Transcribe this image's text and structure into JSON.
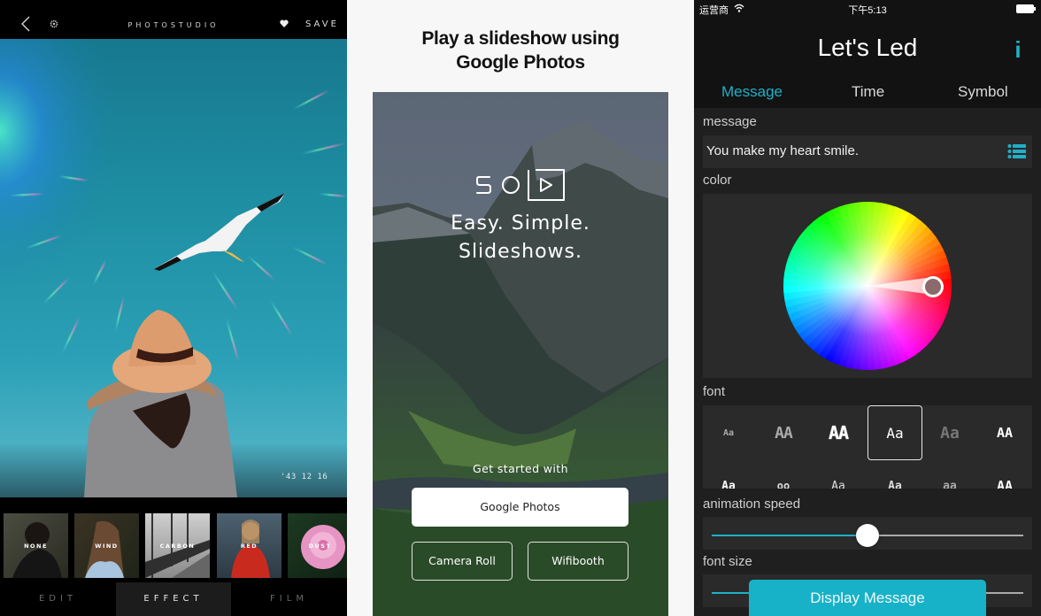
{
  "photostudio": {
    "title": "PHOTOSTUDIO",
    "save_label": "SAVE",
    "icons": {
      "back": "chevron-left-icon",
      "settings": "gear-icon",
      "favorite": "heart-icon"
    },
    "date_stamp": "'43  12  16",
    "filters": [
      {
        "label": "NONE"
      },
      {
        "label": "WIND"
      },
      {
        "label": "CARBON"
      },
      {
        "label": "RED"
      },
      {
        "label": "DUST"
      }
    ],
    "tabs": [
      {
        "label": "EDIT",
        "active": false
      },
      {
        "label": "EFFECT",
        "active": true
      },
      {
        "label": "FILM",
        "active": false
      }
    ]
  },
  "slideshow": {
    "heading_line1": "Play a slideshow using",
    "heading_line2": "Google Photos",
    "logo_text": "SO",
    "tagline_line1": "Easy. Simple.",
    "tagline_line2": "Slideshows.",
    "get_started": "Get started with",
    "buttons": {
      "google_photos": "Google Photos",
      "camera_roll": "Camera Roll",
      "wifibooth": "Wifibooth"
    }
  },
  "letsled": {
    "status": {
      "carrier": "运营商",
      "time": "下午5:13"
    },
    "title": "Let's Led",
    "info_icon": "i",
    "accent_color": "#1fb0c8",
    "tabs": [
      {
        "label": "Message",
        "active": true
      },
      {
        "label": "Time",
        "active": false
      },
      {
        "label": "Symbol",
        "active": false
      }
    ],
    "message_label": "message",
    "message_value": "You make my heart smile.",
    "color_label": "color",
    "selected_color": "#8a6a6a",
    "font_label": "font",
    "font_samples_row1": [
      "Aa",
      "AA",
      "AA",
      "Aa",
      "Aa",
      "AA"
    ],
    "font_samples_row2": [
      "Aa",
      "oo",
      "Aa",
      "Aa",
      "aa",
      "AA"
    ],
    "selected_font_index": 3,
    "animation_speed_label": "animation speed",
    "animation_speed_value": 0.5,
    "font_size_label": "font size",
    "font_size_value": 0.5,
    "display_button": "Display Message"
  }
}
